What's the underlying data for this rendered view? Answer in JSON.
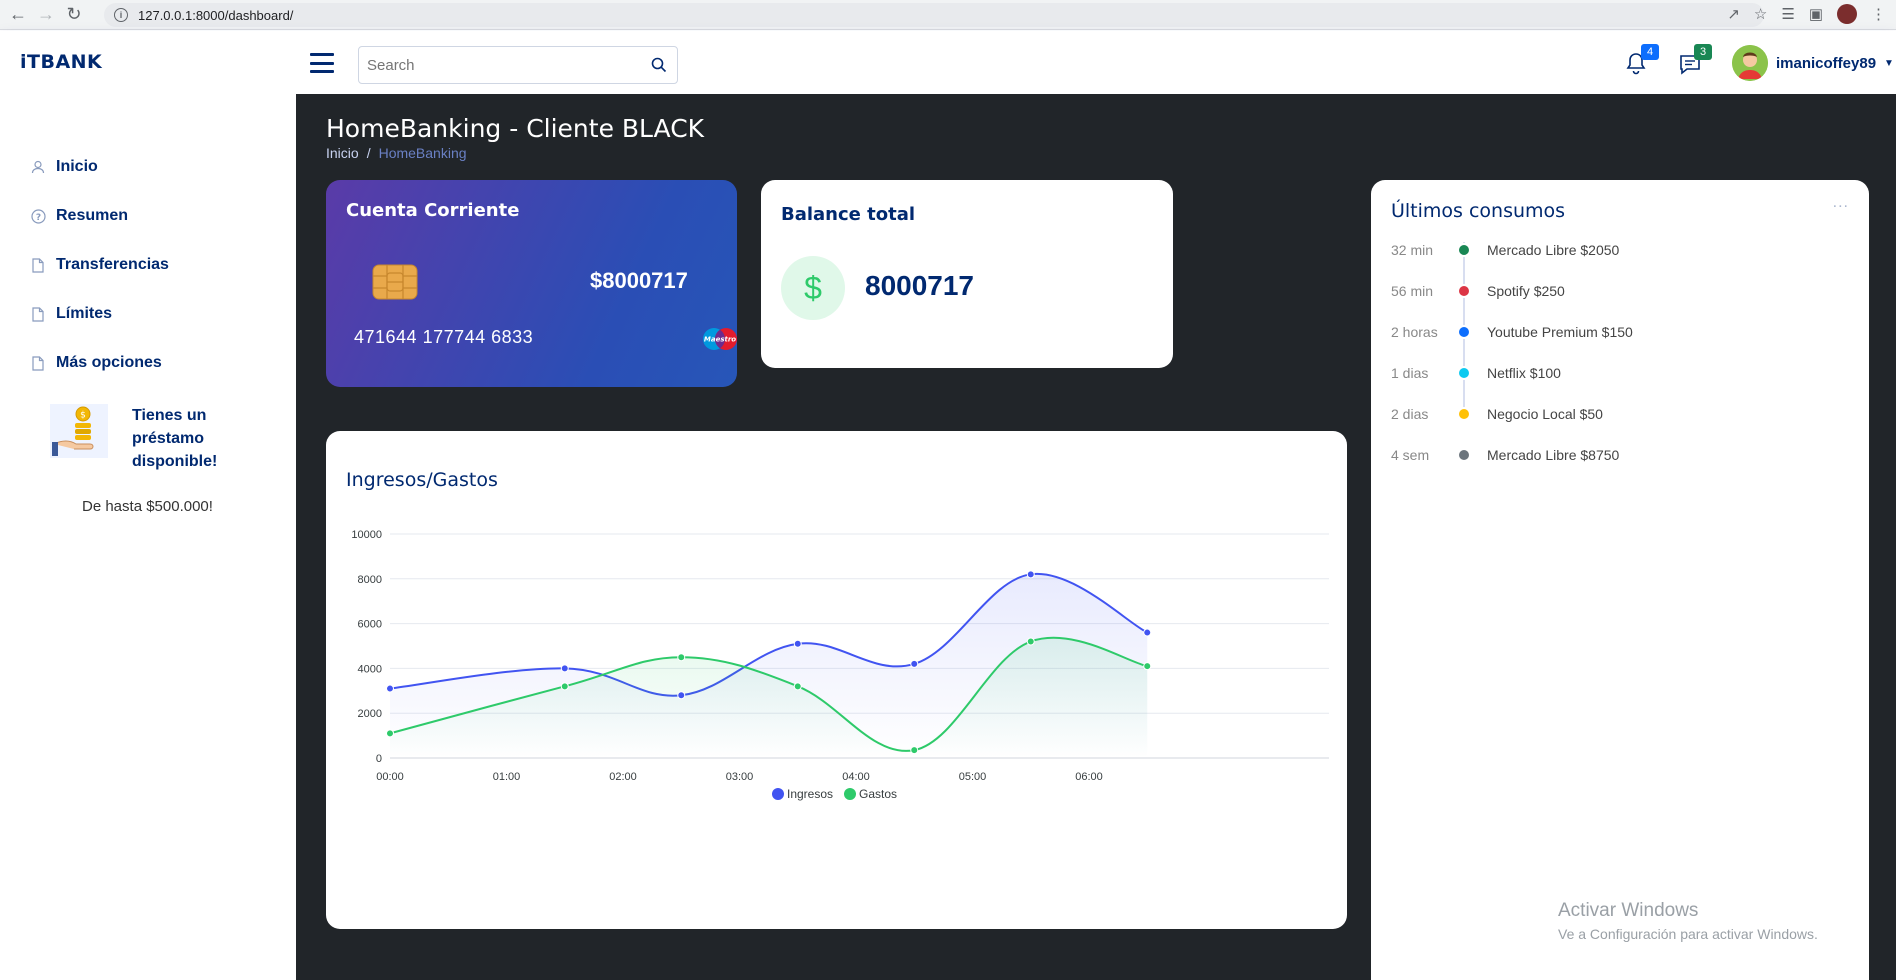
{
  "browser": {
    "url": "127.0.0.1:8000/dashboard/"
  },
  "header": {
    "logo": "iTBANK",
    "search_placeholder": "Search",
    "notifications_count": "4",
    "messages_count": "3",
    "username": "imanicoffey89"
  },
  "sidebar": {
    "items": [
      {
        "label": "Inicio",
        "icon": "person-icon"
      },
      {
        "label": "Resumen",
        "icon": "question-icon"
      },
      {
        "label": "Transferencias",
        "icon": "file-icon"
      },
      {
        "label": "Límites",
        "icon": "file-icon"
      },
      {
        "label": "Más opciones",
        "icon": "file-icon"
      }
    ],
    "promo": {
      "title": "Tienes un préstamo disponible!",
      "subtitle": "De hasta $500.000!"
    }
  },
  "page": {
    "title": "HomeBanking - Cliente BLACK",
    "breadcrumb": {
      "home": "Inicio",
      "separator": "/",
      "active": "HomeBanking"
    }
  },
  "account_card": {
    "title": "Cuenta Corriente",
    "balance": "$8000717",
    "card_number": "471644 177744 6833",
    "brand": "Maestro"
  },
  "balance_card": {
    "title": "Balance total",
    "symbol": "$",
    "value": "8000717"
  },
  "consumos": {
    "title": "Últimos consumos",
    "menu": "...",
    "items": [
      {
        "time": "32 min",
        "desc": "Mercado Libre $2050",
        "color": "#198754"
      },
      {
        "time": "56 min",
        "desc": "Spotify $250",
        "color": "#dc3545"
      },
      {
        "time": "2 horas",
        "desc": "Youtube Premium $150",
        "color": "#0d6efd"
      },
      {
        "time": "1 dias",
        "desc": "Netflix $100",
        "color": "#0dcaf0"
      },
      {
        "time": "2 dias",
        "desc": "Negocio Local $50",
        "color": "#ffc107"
      },
      {
        "time": "4 sem",
        "desc": "Mercado Libre $8750",
        "color": "#6c757d"
      }
    ]
  },
  "chart_card": {
    "title": "Ingresos/Gastos"
  },
  "chart_data": {
    "type": "area",
    "title": "Ingresos/Gastos",
    "x": [
      "00:00",
      "01:30",
      "02:30",
      "03:30",
      "04:30",
      "05:30",
      "06:30"
    ],
    "x_ticks": [
      "00:00",
      "01:00",
      "02:00",
      "03:00",
      "04:00",
      "05:00",
      "06:00"
    ],
    "y_ticks": [
      0,
      2000,
      4000,
      6000,
      8000,
      10000
    ],
    "ylim": [
      0,
      10000
    ],
    "grid": true,
    "legend": "bottom",
    "series": [
      {
        "name": "Ingresos",
        "values": [
          3100,
          4000,
          2800,
          5100,
          4200,
          8200,
          5600
        ],
        "color": "#4154f1"
      },
      {
        "name": "Gastos",
        "values": [
          1100,
          3200,
          4500,
          3200,
          350,
          5200,
          4100
        ],
        "color": "#2eca6a"
      }
    ]
  },
  "watermark": {
    "line1": "Activar Windows",
    "line2": "Ve a Configuración para activar Windows."
  }
}
